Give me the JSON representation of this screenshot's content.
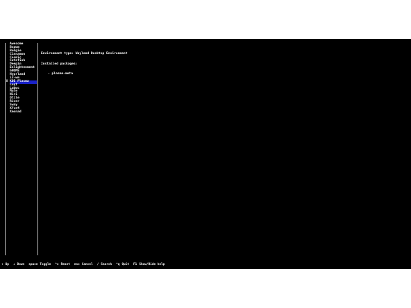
{
  "desktops": [
    {
      "label": "Awesome",
      "mark": ""
    },
    {
      "label": "Bspwm",
      "mark": ""
    },
    {
      "label": "Budgie",
      "mark": ""
    },
    {
      "label": "Cinnamon",
      "mark": ""
    },
    {
      "label": "Cosmic",
      "mark": ""
    },
    {
      "label": "Cutefish",
      "mark": ""
    },
    {
      "label": "Deepin",
      "mark": ""
    },
    {
      "label": "Enlightenment",
      "mark": ""
    },
    {
      "label": "GNOME",
      "mark": ""
    },
    {
      "label": "Hyprland",
      "mark": ""
    },
    {
      "label": "i3-wm",
      "mark": ""
    },
    {
      "label": "KDE Plasma",
      "mark": "X",
      "selected": true
    },
    {
      "label": "Lxqt",
      "mark": ""
    },
    {
      "label": "Labwc",
      "mark": ""
    },
    {
      "label": "Mate",
      "mark": ""
    },
    {
      "label": "Niri",
      "mark": ""
    },
    {
      "label": "Qtile",
      "mark": ""
    },
    {
      "label": "River",
      "mark": ""
    },
    {
      "label": "Sway",
      "mark": ""
    },
    {
      "label": "Xfce4",
      "mark": ""
    },
    {
      "label": "Xmonad",
      "mark": ""
    }
  ],
  "details": {
    "environment_type": "Environment type: Wayland Desktop Environment",
    "installed_heading": "Installed packages:",
    "packages": [
      "- plasma-meta"
    ]
  },
  "footer": [
    {
      "key": "↑",
      "action": "Up"
    },
    {
      "key": "↓",
      "action": "Down"
    },
    {
      "key": "space",
      "action": "Toggle"
    },
    {
      "key": "^c",
      "action": "Reset"
    },
    {
      "key": "esc",
      "action": "Cancel"
    },
    {
      "key": "/",
      "action": "Search"
    },
    {
      "key": "^q",
      "action": "Quit"
    },
    {
      "key": "F1",
      "action": "Show/Hide help"
    }
  ],
  "colors": {
    "terminal_bg": "#000000",
    "text": "#ffffff",
    "selection": "#1a22c9",
    "divider": "#bdbdbd"
  }
}
